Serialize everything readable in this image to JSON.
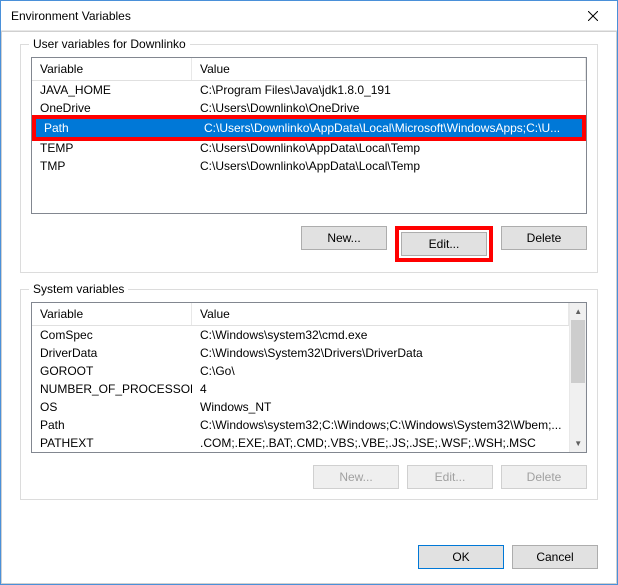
{
  "window": {
    "title": "Environment Variables"
  },
  "user_section": {
    "legend": "User variables for Downlinko",
    "col_variable": "Variable",
    "col_value": "Value",
    "rows": [
      {
        "name": "JAVA_HOME",
        "value": "C:\\Program Files\\Java\\jdk1.8.0_191"
      },
      {
        "name": "OneDrive",
        "value": "C:\\Users\\Downlinko\\OneDrive"
      },
      {
        "name": "Path",
        "value": "C:\\Users\\Downlinko\\AppData\\Local\\Microsoft\\WindowsApps;C:\\U..."
      },
      {
        "name": "TEMP",
        "value": "C:\\Users\\Downlinko\\AppData\\Local\\Temp"
      },
      {
        "name": "TMP",
        "value": "C:\\Users\\Downlinko\\AppData\\Local\\Temp"
      }
    ],
    "btn_new": "New...",
    "btn_edit": "Edit...",
    "btn_delete": "Delete"
  },
  "system_section": {
    "legend": "System variables",
    "col_variable": "Variable",
    "col_value": "Value",
    "rows": [
      {
        "name": "ComSpec",
        "value": "C:\\Windows\\system32\\cmd.exe"
      },
      {
        "name": "DriverData",
        "value": "C:\\Windows\\System32\\Drivers\\DriverData"
      },
      {
        "name": "GOROOT",
        "value": "C:\\Go\\"
      },
      {
        "name": "NUMBER_OF_PROCESSORS",
        "value": "4"
      },
      {
        "name": "OS",
        "value": "Windows_NT"
      },
      {
        "name": "Path",
        "value": "C:\\Windows\\system32;C:\\Windows;C:\\Windows\\System32\\Wbem;..."
      },
      {
        "name": "PATHEXT",
        "value": ".COM;.EXE;.BAT;.CMD;.VBS;.VBE;.JS;.JSE;.WSF;.WSH;.MSC"
      }
    ],
    "btn_new": "New...",
    "btn_edit": "Edit...",
    "btn_delete": "Delete"
  },
  "footer": {
    "btn_ok": "OK",
    "btn_cancel": "Cancel"
  }
}
